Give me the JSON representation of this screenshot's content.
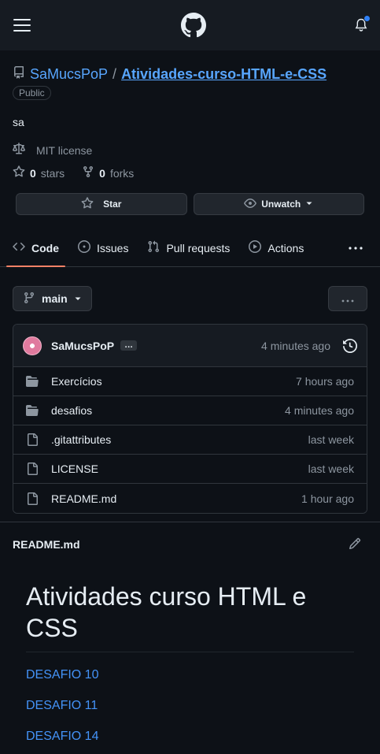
{
  "topbar": {
    "menu_icon": "hamburger-menu-icon",
    "logo_icon": "github-logo-icon",
    "notification_icon": "bell-icon",
    "accent": "#2f81f7"
  },
  "repo": {
    "owner": "SaMucsPoP",
    "separator": "/",
    "name": "Atividades-curso-HTML-e-CSS",
    "visibility": "Public",
    "description": "sa",
    "license": "MIT license",
    "stars_count": "0",
    "stars_label": "stars",
    "forks_count": "0",
    "forks_label": "forks"
  },
  "actions": {
    "star_label": "Star",
    "watch_label": "Unwatch"
  },
  "tabs": [
    {
      "label": "Code",
      "icon": "code-icon"
    },
    {
      "label": "Issues",
      "icon": "issue-opened-icon"
    },
    {
      "label": "Pull requests",
      "icon": "git-pull-request-icon"
    },
    {
      "label": "Actions",
      "icon": "play-icon"
    }
  ],
  "branch": {
    "name": "main"
  },
  "commit": {
    "author": "SaMucsPoP",
    "ellipsis": "…",
    "time": "4 minutes ago"
  },
  "files": [
    {
      "name": "Exercícios",
      "type": "folder",
      "time": "7 hours ago"
    },
    {
      "name": "desafios",
      "type": "folder",
      "time": "4 minutes ago"
    },
    {
      "name": ".gitattributes",
      "type": "file",
      "time": "last week"
    },
    {
      "name": "LICENSE",
      "type": "file",
      "time": "last week"
    },
    {
      "name": "README.md",
      "type": "file",
      "time": "1 hour ago"
    }
  ],
  "readme": {
    "filename": "README.md",
    "heading": "Atividades curso HTML e CSS",
    "links": [
      "DESAFIO 10",
      "DESAFIO 11",
      "DESAFIO 14"
    ]
  }
}
